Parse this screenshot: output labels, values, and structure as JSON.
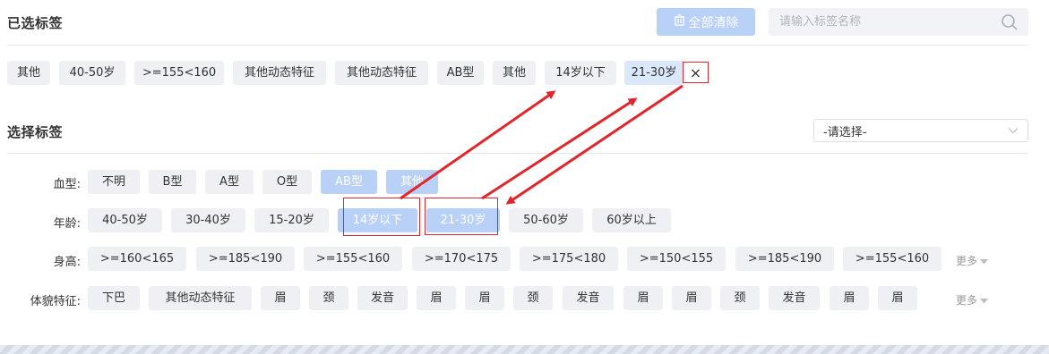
{
  "header": {
    "selected_title": "已选标签",
    "clear_label": "全部清除",
    "search_placeholder": "请输入标签名称"
  },
  "selected_tags": [
    "其他",
    "40-50岁",
    ">=155<160",
    "其他动态特征",
    "其他动态特征",
    "AB型",
    "其他",
    "14岁以下",
    "21-30岁"
  ],
  "remove_symbol": "×",
  "choose": {
    "title": "选择标签",
    "select_value": "-请选择-"
  },
  "rows": {
    "blood": {
      "label": "血型:",
      "tags": [
        "不明",
        "B型",
        "A型",
        "O型",
        "AB型",
        "其他"
      ]
    },
    "age": {
      "label": "年龄:",
      "tags": [
        "40-50岁",
        "30-40岁",
        "15-20岁",
        "14岁以下",
        "21-30岁",
        "50-60岁",
        "60岁以上"
      ]
    },
    "height": {
      "label": "身高:",
      "tags": [
        ">=160<165",
        ">=185<190",
        ">=155<160",
        ">=170<175",
        ">=175<180",
        ">=150<155",
        ">=185<190",
        ">=155<160"
      ],
      "more_label": "更多"
    },
    "body": {
      "label": "体貌特征:",
      "tags": [
        "下巴",
        "其他动态特征",
        "眉",
        "颈",
        "发音",
        "眉",
        "眉",
        "颈",
        "发音",
        "眉",
        "眉",
        "颈",
        "发音",
        "眉",
        "眉"
      ],
      "more_label": "更多"
    }
  },
  "colors": {
    "accent_light": "#b9d1f7",
    "tag_bg": "#eef0f4",
    "annotation_red": "#e0252b"
  }
}
